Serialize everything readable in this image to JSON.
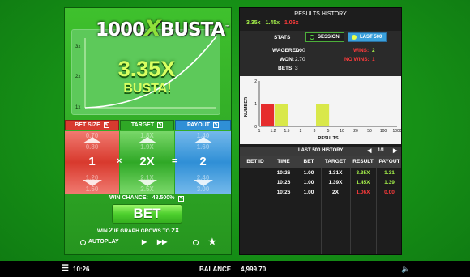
{
  "game": {
    "logo_number": "1000",
    "logo_x": "X",
    "logo_word": "BUSTA",
    "logo_tm": "™",
    "multiplier": "3.35X",
    "status": "BUSTA!",
    "graph_y_ticks": [
      "3x",
      "2x",
      "1x"
    ]
  },
  "bet_size": {
    "label": "BET SIZE",
    "value": "1",
    "ghost_above": [
      "0.70",
      "0.80"
    ],
    "ghost_below": [
      "1.50",
      "1.20"
    ],
    "color": "#d83a2f"
  },
  "target": {
    "label": "TARGET",
    "value": "2X",
    "ghost_above": [
      "1.8X",
      "1.9X"
    ],
    "ghost_below": [
      "2.5X",
      "2.1X"
    ],
    "color": "#2fa826"
  },
  "payout": {
    "label": "PAYOUT",
    "value": "2",
    "ghost_above": [
      "1.40",
      "1.60"
    ],
    "ghost_below": [
      "3.00",
      "2.40"
    ],
    "color": "#2f8fd6"
  },
  "operators": {
    "multiply": "×",
    "equals": "="
  },
  "win_chance": {
    "label": "WIN CHANCE:",
    "value": "48.500%"
  },
  "bet_button": "BET",
  "win_text": {
    "prefix": "WIN",
    "amount": "2",
    "middle": "IF GRAPH GROWS TO",
    "target": "2X"
  },
  "autoplay": {
    "label": "AUTOPLAY"
  },
  "results_history": {
    "title": "RESULTS HISTORY",
    "values": [
      {
        "v": "3.35x",
        "color": "#a6f24a"
      },
      {
        "v": "1.45x",
        "color": "#a6f24a"
      },
      {
        "v": "1.06x",
        "color": "#ff3b3b"
      }
    ]
  },
  "stats": {
    "label": "STATS",
    "session_tab": "SESSION",
    "last500_tab": "LAST 500",
    "wagered_label": "WAGERED:",
    "wagered": "3.00",
    "won_label": "WON:",
    "won": "2.70",
    "bets_label": "BETS:",
    "bets": "3",
    "wins_label": "WINS:",
    "wins": "2",
    "nowins_label": "NO WINS:",
    "nowins": "1"
  },
  "chart_data": {
    "type": "bar",
    "ylabel": "NUMBER",
    "xlabel": "RESULTS",
    "ylim": [
      0,
      2
    ],
    "y_ticks": [
      "2",
      "1",
      "0"
    ],
    "categories": [
      "1",
      "1.2",
      "1.5",
      "2",
      "3",
      "5",
      "10",
      "20",
      "50",
      "100",
      "1000"
    ],
    "values": [
      1,
      1,
      0,
      0,
      1,
      0,
      0,
      0,
      0,
      0,
      0
    ],
    "bar_colors": [
      "#e62d2d",
      "#d9e84a",
      "#d9e84a",
      "#d9e84a",
      "#d9e84a",
      "#d9e84a",
      "#d9e84a",
      "#d9e84a",
      "#d9e84a",
      "#d9e84a",
      "#d9e84a"
    ]
  },
  "history": {
    "title": "LAST 500 HISTORY",
    "page": "1/1",
    "columns": [
      "BET ID",
      "TIME",
      "BET",
      "TARGET",
      "RESULT",
      "PAYOUT"
    ],
    "rows": [
      {
        "time": "10:26",
        "bet": "1.00",
        "target": "1.31X",
        "result": "3.35X",
        "payout": "1.31",
        "win": true
      },
      {
        "time": "10:26",
        "bet": "1.00",
        "target": "1.39X",
        "result": "1.45X",
        "payout": "1.39",
        "win": true
      },
      {
        "time": "10:26",
        "bet": "1.00",
        "target": "2X",
        "result": "1.06X",
        "payout": "0.00",
        "win": false
      }
    ]
  },
  "footer": {
    "time": "10:26",
    "balance_label": "BALANCE",
    "balance": "4,999.70"
  }
}
